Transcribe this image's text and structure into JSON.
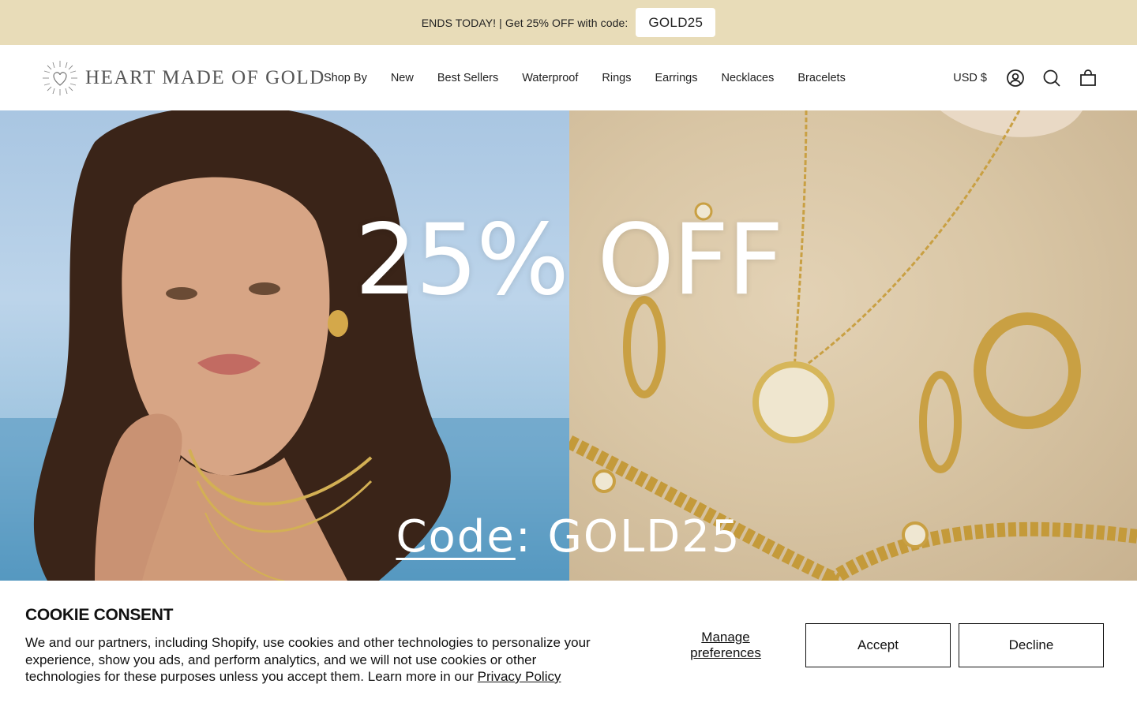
{
  "announcement": {
    "text": "ENDS TODAY! | Get 25% OFF with code:",
    "code": "GOLD25"
  },
  "header": {
    "logo_text": "HEART MADE OF GOLD",
    "nav": [
      "Shop By",
      "New",
      "Best Sellers",
      "Waterproof",
      "Rings",
      "Earrings",
      "Necklaces",
      "Bracelets"
    ],
    "currency": "USD $",
    "icons": [
      "account-icon",
      "search-icon",
      "cart-icon"
    ]
  },
  "hero": {
    "headline": "25% OFF",
    "code_label": "Code",
    "code_separator": ":",
    "code_value": "GOLD25"
  },
  "cookie": {
    "title": "COOKIE CONSENT",
    "body": "We and our partners, including Shopify, use cookies and other technologies to personalize your experience, show you ads, and perform analytics, and we will not use cookies or other technologies for these purposes unless you accept them. Learn more in our ",
    "privacy_link": "Privacy Policy",
    "manage_label": "Manage preferences",
    "accept_label": "Accept",
    "decline_label": "Decline"
  },
  "colors": {
    "announcement_bg": "#e8dcb8",
    "text": "#111111"
  }
}
